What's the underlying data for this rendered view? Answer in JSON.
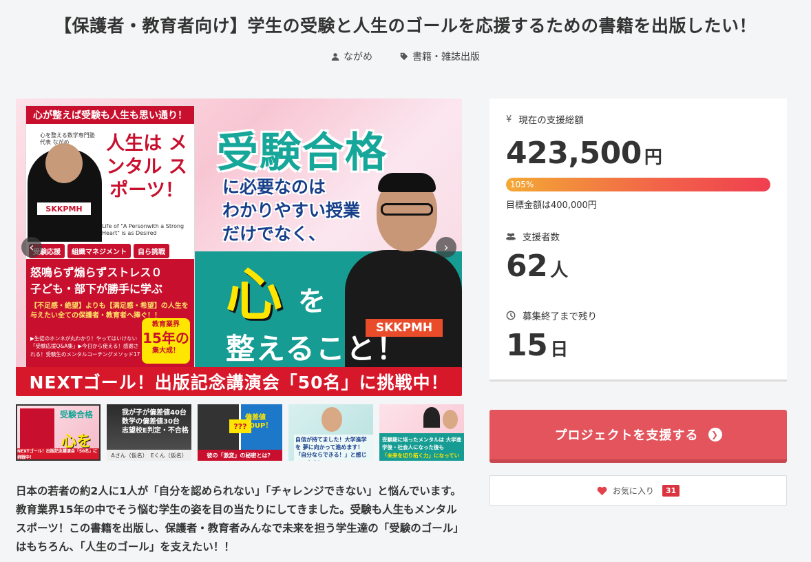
{
  "project": {
    "title": "【保護者・教育者向け】学生の受験と人生のゴールを応援するための書籍を出版したい！",
    "owner": "ながめ",
    "category": "書籍・雑誌出版",
    "description": "日本の若者の約2人に1人が「自分を認められない」「チャレンジできない」と悩んでいます。教育業界15年の中でそう悩む学生の姿を目の当たりにしてきました。受験も人生もメンタルスポーツ！この書籍を出版し、保護者・教育者みんなで未来を担う学生達の「受験のゴール」はもちろん、「人生のゴール」を支えたい！！"
  },
  "hero": {
    "book_top_banner": "心が整えば受験も人生も思い通り！",
    "book_author": "心を整える数学専門塾 代表 ながめ",
    "book_title": "人生は メンタル スポーツ！",
    "book_subtitle_en": "Life of \"A Personwith a Strong Heart\" is as Desired",
    "book_tags": [
      "受験応援",
      "組織マネジメント",
      "自ら挑戦"
    ],
    "book_line1": "怒鳴らず煽らずストレス０",
    "book_line2": "子ども・部下が勝手に学ぶ",
    "book_line3": "【不足感・絶望】よりも【満足感・希望】の人生を与えたい全ての保護者・教育者へ捧ぐ！！",
    "book_line4": "▶生徒のホンネが丸わかり！やってはいけない「受験応援Q&A集」▶今日から使える！感謝される！受験生のメンタルコーチングメソッド17",
    "book_badge_top": "教育業界",
    "book_badge_num": "15年の",
    "book_badge_bottom": "集大成！",
    "shirt_logo": "SKKPMH",
    "headline": "受験合格",
    "sub1": "に必要なのは",
    "sub2": "わかりやすい授業",
    "sub3": "だけでなく、",
    "kokoro": "心",
    "wo": "を",
    "totonoeru": "整えること！",
    "bottom_bar": "NEXTゴール！出版記念講演会「50名」に挑戦中！",
    "prev_arrow": "‹",
    "next_arrow": "›"
  },
  "thumbnails": [
    {
      "title": "受験合格",
      "main": "心を",
      "caption": "NEXTゴール！出版記念講演会「50名」に挑戦中！"
    },
    {
      "line1": "我が子が偏差値40台",
      "line2": "数学の偏差値30台",
      "line3": "志望校E判定・不合格",
      "caption": "Aさん（仮名）　Eくん（仮名）"
    },
    {
      "q": "???",
      "score": "偏差値 20UP！",
      "caption": "彼の「激変」の秘密とは？"
    },
    {
      "text": "自信が持てました！大学進学を 夢に向かって進めます！「自分ならできる！」と感じています！"
    },
    {
      "text": "受験期に培ったメンタルは 大学進学後・社会人になった後も",
      "highlight": "「未来を切り拓く力」になっている！"
    }
  ],
  "stats": {
    "amount_label": "現在の支援総額",
    "amount_value": "423,500",
    "amount_unit": "円",
    "progress_percent": 105,
    "progress_label": "105%",
    "goal_text": "目標金額は400,000円",
    "supporters_label": "支援者数",
    "supporters_value": "62",
    "supporters_unit": "人",
    "remaining_label": "募集終了まで残り",
    "remaining_value": "15",
    "remaining_unit": "日",
    "currency_icon": "¥"
  },
  "actions": {
    "support_label": "プロジェクトを支援する",
    "favorite_label": "お気に入り",
    "favorite_count": "31"
  },
  "icons": {
    "owner": "user-icon",
    "category": "tag-icon",
    "supporters": "users-icon",
    "remaining": "clock-icon",
    "support": "chevron-circle-right-icon",
    "favorite": "heart-icon"
  },
  "colors": {
    "support_button": "#e3545d",
    "progress_start": "#f3a934",
    "progress_end": "#ef3f4f",
    "favorite_badge": "#d9343f"
  }
}
